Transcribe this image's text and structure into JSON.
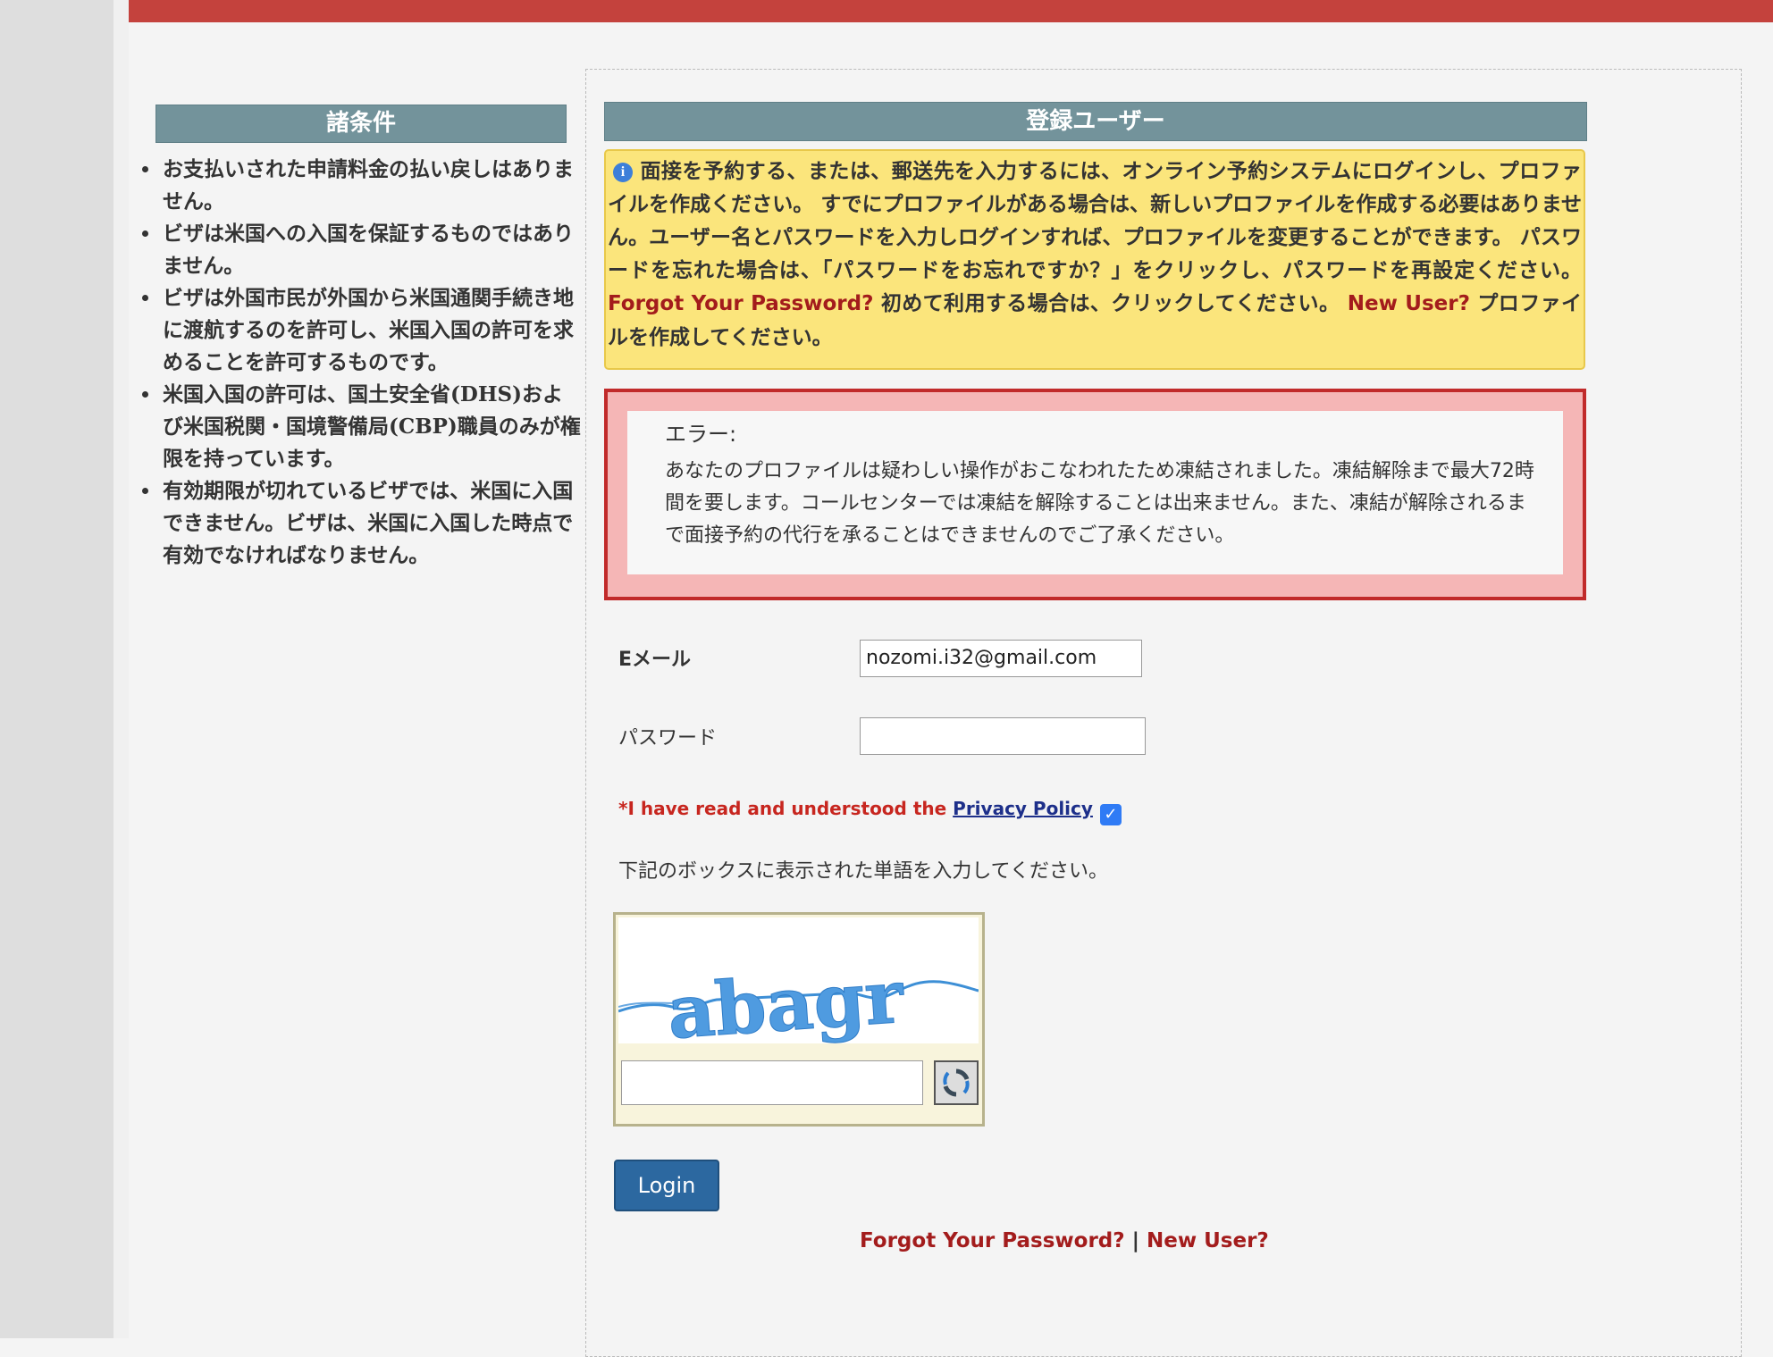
{
  "conditions": {
    "title": "諸条件",
    "items": [
      "お支払いされた申請料金の払い戻しはありません。",
      "ビザは米国への入国を保証するものではありません。",
      "ビザは外国市民が外国から米国通関手続き地に渡航するのを許可し、米国入国の許可を求めることを許可するものです。",
      "米国入国の許可は、国土安全省(DHS)および米国税関・国境警備局(CBP)職員のみが権限を持っています。",
      "有効期限が切れているビザでは、米国に入国できません。ビザは、米国に入国した時点で有効でなければなりません。"
    ]
  },
  "registered": {
    "title": "登録ユーザー",
    "info_text_1": "面接を予約する、または、郵送先を入力するには、オンライン予約システムにログインし、プロファイルを作成ください。 すでにプロファイルがある場合は、新しいプロファイルを作成する必要はありません。ユーザー名とパスワードを入力しログインすれば、プロファイルを変更することができます。 パスワードを忘れた場合は、「パスワードをお忘れですか？」をクリックし、パスワードを再設定ください。 ",
    "info_link_forgot": "Forgot Your Password?",
    "info_text_2": " 初めて利用する場合は、クリックしてください。 ",
    "info_link_new": "New User?",
    "info_text_3": " プロファイルを作成してください。"
  },
  "error": {
    "title": "エラー:",
    "message": "あなたのプロファイルは疑わしい操作がおこなわれたため凍結されました。凍結解除まで最大72時間を要します。コールセンターでは凍結を解除することは出来ません。また、凍結が解除されるまで面接予約の代行を承ることはできませんのでご了承ください。"
  },
  "form": {
    "email_label": "Eメール",
    "email_value": "nozomi.i32@gmail.com",
    "password_label": "パスワード",
    "password_value": "",
    "privacy_text": "*I have read and understood the ",
    "privacy_link": "Privacy Policy",
    "privacy_checked": true,
    "captcha_instruction": "下記のボックスに表示された単語を入力してください。",
    "captcha_word": "abagr",
    "login_label": "Login"
  },
  "bottom_links": {
    "forgot": "Forgot Your Password?",
    "separator": "|",
    "new_user": "New User?"
  },
  "colors": {
    "top_bar": "#c4423d",
    "header_bg": "#73939b",
    "info_bg": "#fbe57c",
    "error_border": "#c12a2a",
    "link_red": "#a31c1c",
    "button_blue": "#2c68a0"
  }
}
